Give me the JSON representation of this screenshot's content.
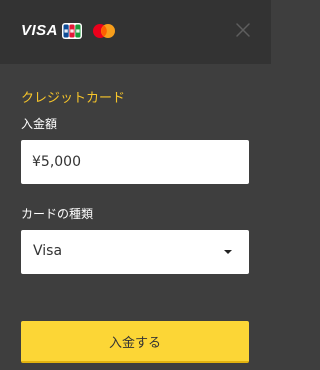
{
  "header": {
    "brands": [
      {
        "name": "Visa",
        "text": "VISA",
        "icon": "visa-logo"
      },
      {
        "name": "JCB",
        "text": "JCB",
        "icon": "jcb-logo"
      },
      {
        "name": "Mastercard",
        "icon": "mastercard-logo"
      }
    ],
    "close_icon": "close-icon"
  },
  "form": {
    "section_title": "クレジットカード",
    "amount_label": "入金額",
    "amount_value": "¥5,000",
    "card_type_label": "カードの種類",
    "card_type_value": "Visa",
    "submit_label": "入金する"
  },
  "colors": {
    "background": "#3e3e3e",
    "header": "#333333",
    "accent": "#f7c52a",
    "button": "#fcd636"
  }
}
